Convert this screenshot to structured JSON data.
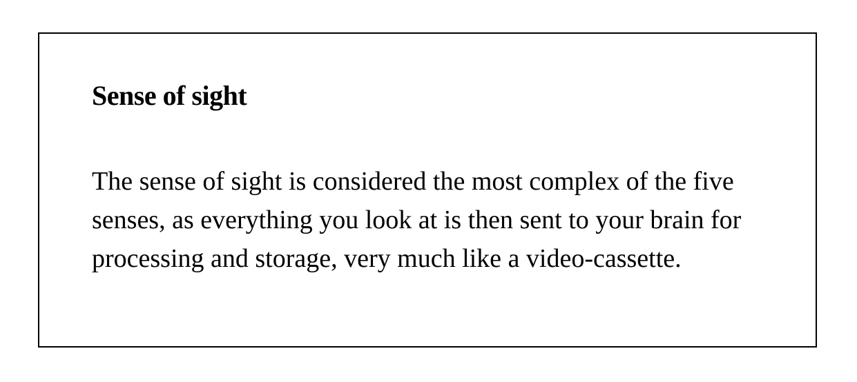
{
  "card": {
    "title": "Sense of sight",
    "lines": [
      "The sense of sight is considered the most complex of the five",
      "senses, as everything you look at is then sent to your brain for",
      "processing and storage, very much like a video-cassette."
    ]
  },
  "colors": {
    "text": "#000000",
    "border": "#000000",
    "background": "#ffffff"
  }
}
